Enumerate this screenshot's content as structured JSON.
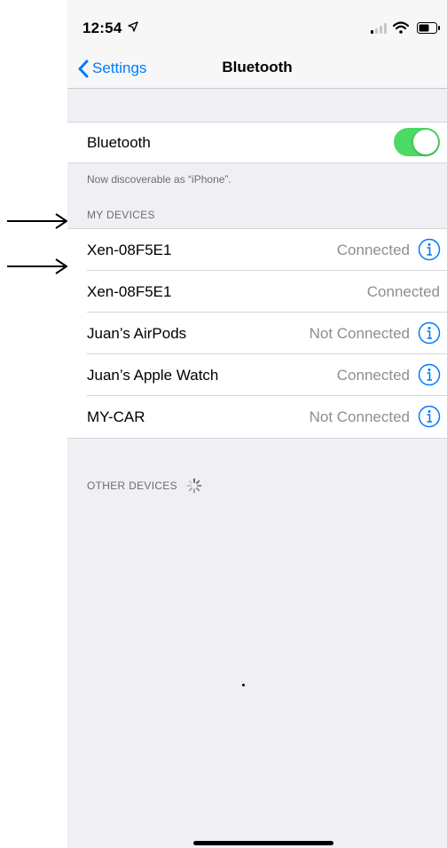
{
  "status_bar": {
    "time": "12:54"
  },
  "nav": {
    "back_label": "Settings",
    "title": "Bluetooth"
  },
  "bluetooth": {
    "label": "Bluetooth",
    "enabled": true,
    "discoverable_note": "Now discoverable as “iPhone”."
  },
  "my_devices": {
    "header": "MY DEVICES",
    "items": [
      {
        "name": "Xen-08F5E1",
        "status": "Connected",
        "has_info": true
      },
      {
        "name": "Xen-08F5E1",
        "status": "Connected",
        "has_info": false
      },
      {
        "name": "Juan’s AirPods",
        "status": "Not Connected",
        "has_info": true
      },
      {
        "name": "Juan’s Apple Watch",
        "status": "Connected",
        "has_info": true
      },
      {
        "name": "MY-CAR",
        "status": "Not Connected",
        "has_info": true
      }
    ]
  },
  "other_devices": {
    "header": "OTHER DEVICES"
  },
  "colors": {
    "accent": "#007aff",
    "toggle_on": "#4cd964",
    "secondary_text": "#8e8e93",
    "group_background": "#efeff4"
  }
}
